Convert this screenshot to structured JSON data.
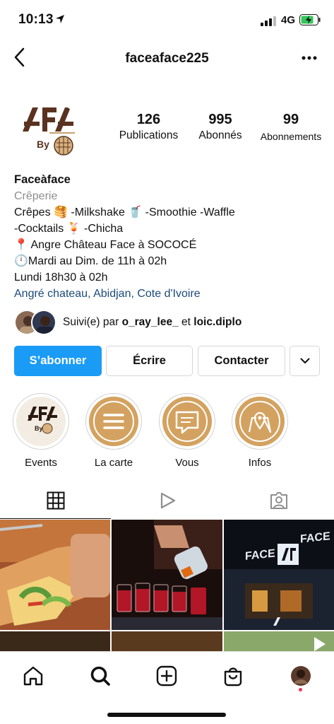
{
  "status": {
    "time": "10:13",
    "network": "4G"
  },
  "header": {
    "username": "faceaface225"
  },
  "profile": {
    "logo_text": "By",
    "stats": [
      {
        "value": "126",
        "label": "Publications"
      },
      {
        "value": "995",
        "label": "Abonnés"
      },
      {
        "value": "99",
        "label": "Abonnements"
      }
    ],
    "name": "Faceàface",
    "category": "Crêperie",
    "bio_lines": [
      "Crêpes 🥞 -Milkshake 🥤 -Smoothie -Waffle",
      "-Cocktails 🍹 -Chicha",
      "📍 Angre Château Face à SOCOCÉ",
      "🕛Mardi au Dim. de 11h à 02h",
      "Lundi 18h30 à 02h"
    ],
    "location_link": "Angré chateau, Abidjan, Cote d'Ivoire"
  },
  "followed_by": {
    "prefix": "Suivi(e) par ",
    "user1": "o_ray_lee_",
    "connector": " et ",
    "user2": "loic.diplo"
  },
  "actions": {
    "follow": "S’abonner",
    "message": "Écrire",
    "contact": "Contacter"
  },
  "highlights": [
    {
      "label": "Events",
      "icon": "logo"
    },
    {
      "label": "La carte",
      "icon": "menu-icon"
    },
    {
      "label": "Vous",
      "icon": "chat-icon"
    },
    {
      "label": "Infos",
      "icon": "map-pin-icon"
    }
  ],
  "tabs": [
    "grid-icon",
    "reels-icon",
    "tagged-icon"
  ],
  "grid_posts": [
    {
      "subject": "crepe with salad"
    },
    {
      "subject": "shots being poured"
    },
    {
      "subject": "storefront",
      "sign_left": "FACE",
      "sign_right": "FACE"
    }
  ],
  "colors": {
    "accent": "#1a9bf5",
    "highlight_gold": "#d4a260",
    "link": "#1b4a7a",
    "brand_brown": "#5a3320"
  }
}
